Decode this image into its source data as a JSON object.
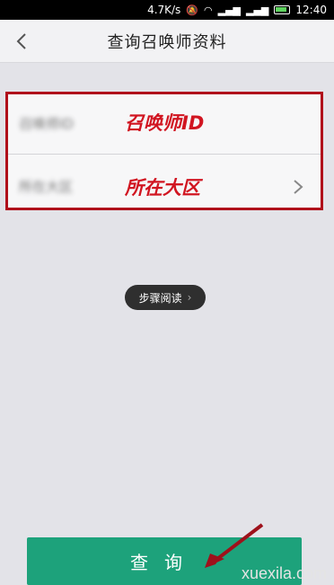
{
  "status_bar": {
    "speed": "4.7K/s",
    "time": "12:40"
  },
  "nav": {
    "title": "查询召唤师资料"
  },
  "form": {
    "row1": {
      "blurred_label": "召唤师ID",
      "overlay": "召唤师ID"
    },
    "row2": {
      "blurred_label": "所在大区",
      "overlay": "所在大区"
    }
  },
  "step_pill": {
    "label": "步骤阅读"
  },
  "actions": {
    "query_label": "查询"
  },
  "watermark": {
    "text": "xuexila.com"
  },
  "colors": {
    "accent_green": "#1da27b",
    "annotation_red": "#d11521",
    "background": "#e3e3e8"
  }
}
